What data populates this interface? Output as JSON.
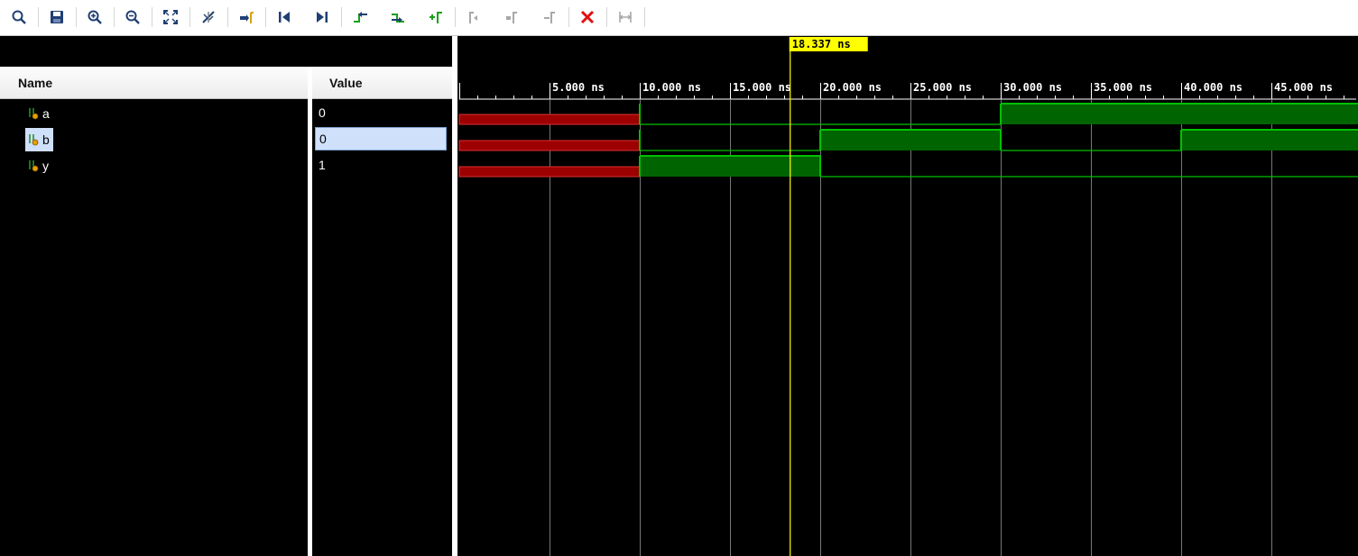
{
  "toolbar": {
    "buttons": [
      {
        "name": "search-button",
        "icon": "search-icon",
        "enabled": true
      },
      {
        "name": "save-button",
        "icon": "save-icon",
        "enabled": true
      },
      {
        "name": "zoom-in-button",
        "icon": "zoom-in-icon",
        "enabled": true
      },
      {
        "name": "zoom-out-button",
        "icon": "zoom-out-icon",
        "enabled": true
      },
      {
        "name": "zoom-fit-button",
        "icon": "zoom-fit-icon",
        "enabled": true
      },
      {
        "name": "zoom-to-cursor-button",
        "icon": "cursor-zoom-icon",
        "enabled": true
      },
      {
        "name": "go-to-cursor-button",
        "icon": "go-to-cursor-icon",
        "enabled": true
      },
      {
        "name": "go-to-time-zero-button",
        "icon": "go-to-start-icon",
        "enabled": true
      },
      {
        "name": "go-to-last-time-button",
        "icon": "go-to-end-icon",
        "enabled": true
      },
      {
        "name": "previous-transition-button",
        "icon": "previous-transition-icon",
        "enabled": true
      },
      {
        "name": "next-transition-button",
        "icon": "next-transition-icon",
        "enabled": true
      },
      {
        "name": "add-marker-button",
        "icon": "add-marker-icon",
        "enabled": true
      },
      {
        "name": "previous-marker-button",
        "icon": "previous-marker-icon",
        "enabled": false
      },
      {
        "name": "next-marker-button",
        "icon": "next-marker-icon",
        "enabled": false
      },
      {
        "name": "delete-marker-button",
        "icon": "delete-marker-icon",
        "enabled": false
      },
      {
        "name": "delete-all-markers-button",
        "icon": "close-red-icon",
        "enabled": true
      },
      {
        "name": "snap-button",
        "icon": "snap-icon",
        "enabled": false
      }
    ]
  },
  "columns": {
    "name_header": "Name",
    "value_header": "Value"
  },
  "signals": [
    {
      "name": "a",
      "value": "0",
      "selected": false,
      "icon": "signal-bit-icon"
    },
    {
      "name": "b",
      "value": "0",
      "selected": true,
      "icon": "signal-bit-icon"
    },
    {
      "name": "y",
      "value": "1",
      "selected": false,
      "icon": "signal-bit-icon"
    }
  ],
  "timeline": {
    "unit": "ns",
    "range_ns": [
      0,
      50
    ],
    "ticks": [
      "5.000 ns",
      "10.000 ns",
      "15.000 ns",
      "20.000 ns",
      "25.000 ns",
      "30.000 ns",
      "35.000 ns",
      "40.000 ns",
      "45.000 ns"
    ],
    "tick_values_ns": [
      5,
      10,
      15,
      20,
      25,
      30,
      35,
      40,
      45
    ],
    "cursor_ns": 18.337,
    "cursor_label": "18.337 ns"
  },
  "waveforms": {
    "a": [
      {
        "from": 0,
        "to": 10,
        "v": "X"
      },
      {
        "from": 10,
        "to": 30,
        "v": 0
      },
      {
        "from": 30,
        "to": 50,
        "v": 1
      }
    ],
    "b": [
      {
        "from": 0,
        "to": 10,
        "v": "X"
      },
      {
        "from": 10,
        "to": 20,
        "v": 0
      },
      {
        "from": 20,
        "to": 30,
        "v": 1
      },
      {
        "from": 30,
        "to": 40,
        "v": 0
      },
      {
        "from": 40,
        "to": 50,
        "v": 1
      }
    ],
    "y": [
      {
        "from": 0,
        "to": 10,
        "v": "X"
      },
      {
        "from": 10,
        "to": 20,
        "v": 1
      },
      {
        "from": 20,
        "to": 50,
        "v": 0
      }
    ]
  },
  "colors": {
    "accent_green": "#00c000",
    "fill_green": "#006400",
    "undefined_red": "#9c0000",
    "cursor_yellow": "#ffff00",
    "selection_blue": "#cfe0fb"
  }
}
